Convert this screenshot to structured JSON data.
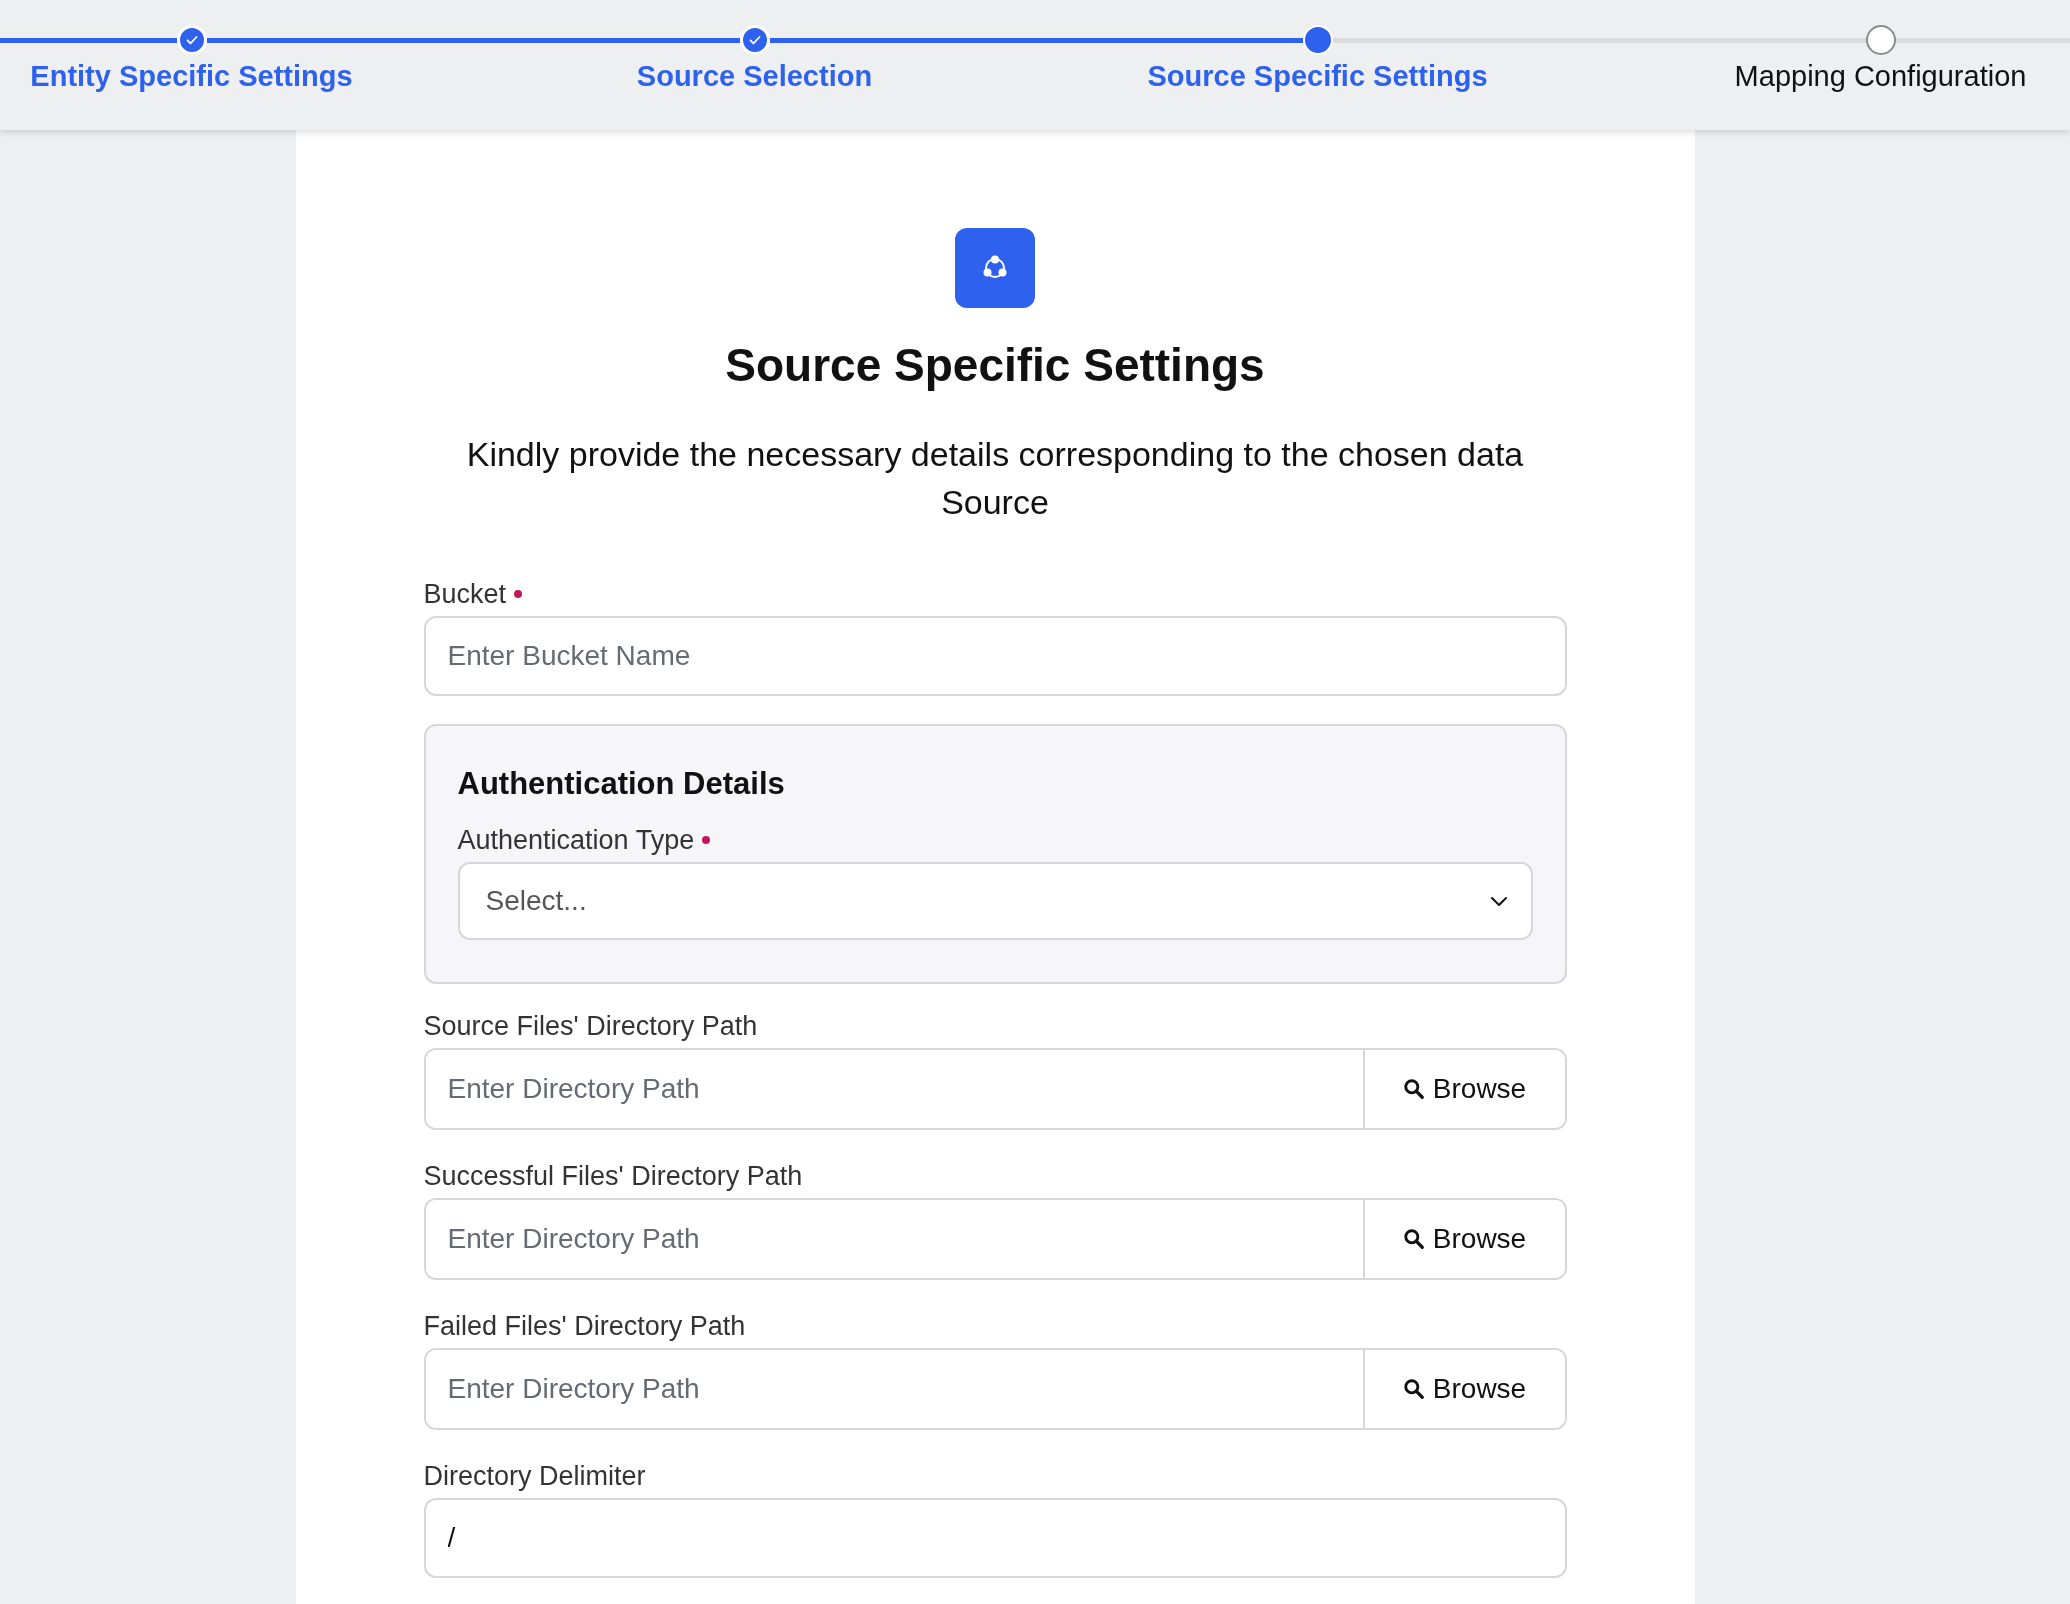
{
  "stepper": {
    "steps": [
      {
        "label": "Entity Specific Settings",
        "completed": true,
        "selected": false
      },
      {
        "label": "Source Selection",
        "completed": true,
        "selected": false
      },
      {
        "label": "Source Specific Settings",
        "completed": false,
        "selected": true
      },
      {
        "label": "Mapping Configuration",
        "completed": false,
        "selected": false
      }
    ]
  },
  "form": {
    "title": "Source Specific Settings",
    "subtitle": "Kindly provide the necessary details corresponding to the chosen data Source",
    "items": [
      {
        "kind": "text",
        "label": "Bucket",
        "required": true,
        "placeholder": "Enter Bucket Name"
      },
      {
        "kind": "panel",
        "title": "Authentication Details",
        "fields": [
          {
            "kind": "select",
            "label": "Authentication Type",
            "required": true,
            "placeholder": "Select..."
          }
        ]
      },
      {
        "kind": "browse",
        "label": "Source Files' Directory Path",
        "required": false,
        "placeholder": "Enter Directory Path",
        "button": "Browse"
      },
      {
        "kind": "browse",
        "label": "Successful Files' Directory Path",
        "required": false,
        "placeholder": "Enter Directory Path",
        "button": "Browse"
      },
      {
        "kind": "browse",
        "label": "Failed Files' Directory Path",
        "required": false,
        "placeholder": "Enter Directory Path",
        "button": "Browse"
      },
      {
        "kind": "text",
        "label": "Directory Delimiter",
        "required": false,
        "value": "/"
      }
    ]
  }
}
